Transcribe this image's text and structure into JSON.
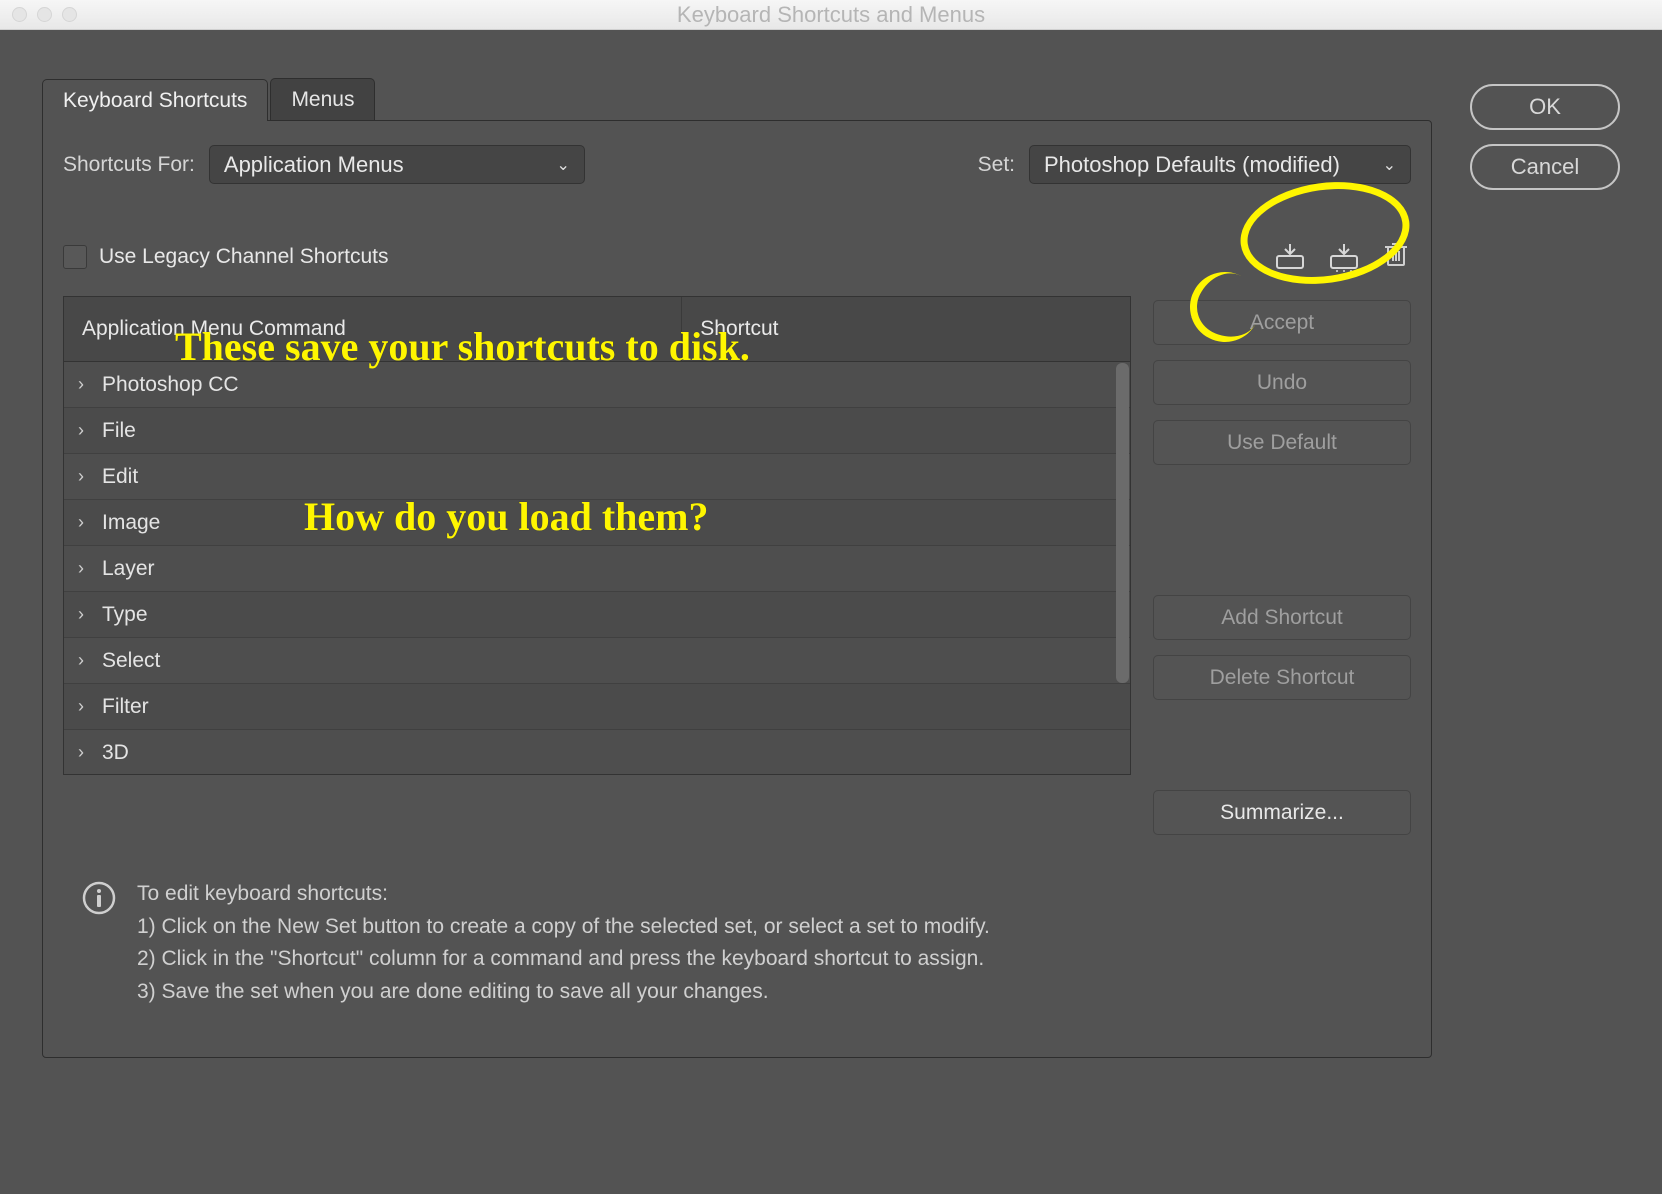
{
  "window": {
    "title": "Keyboard Shortcuts and Menus"
  },
  "tabs": {
    "shortcuts": "Keyboard Shortcuts",
    "menus": "Menus"
  },
  "labels": {
    "shortcuts_for": "Shortcuts For:",
    "set": "Set:",
    "use_legacy": "Use Legacy Channel Shortcuts"
  },
  "selects": {
    "shortcuts_for_value": "Application Menus",
    "set_value": "Photoshop Defaults (modified)"
  },
  "table": {
    "col1": "Application Menu Command",
    "col2": "Shortcut",
    "rows": [
      "Photoshop CC",
      "File",
      "Edit",
      "Image",
      "Layer",
      "Type",
      "Select",
      "Filter",
      "3D"
    ]
  },
  "buttons": {
    "accept": "Accept",
    "undo": "Undo",
    "use_default": "Use Default",
    "add_shortcut": "Add Shortcut",
    "delete_shortcut": "Delete Shortcut",
    "summarize": "Summarize...",
    "ok": "OK",
    "cancel": "Cancel"
  },
  "info": {
    "line0": "To edit keyboard shortcuts:",
    "line1": "1) Click on the New Set button to create a copy of the selected set, or select a set to modify.",
    "line2": "2) Click in the \"Shortcut\" column for a command and press the keyboard shortcut to assign.",
    "line3": "3) Save the set when you are done editing to save all your changes."
  },
  "annotations": {
    "text1": "These save your shortcuts to disk.",
    "text2": "How do you load them?"
  }
}
